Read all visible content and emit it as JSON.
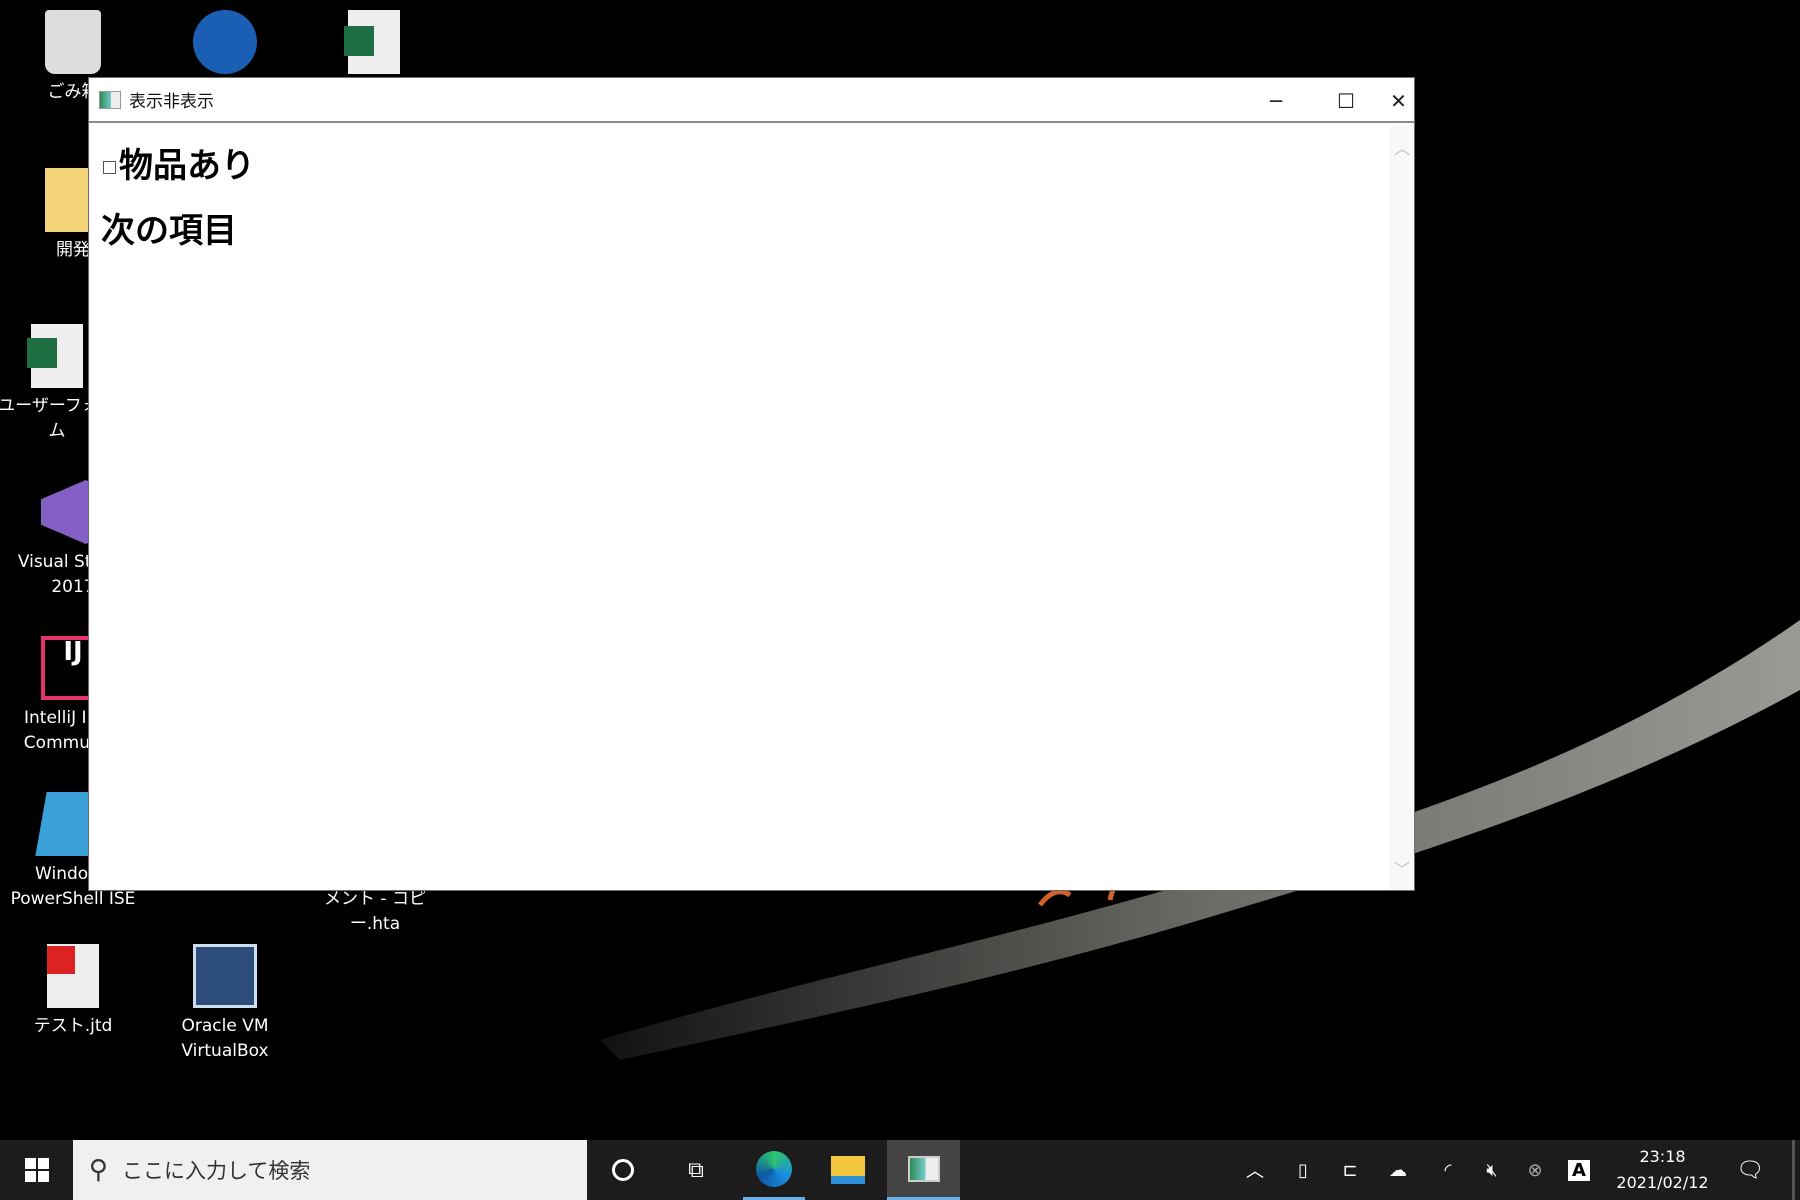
{
  "desktop": {
    "icons": [
      {
        "label": "ごみ箱",
        "icon": "recycle-bin-icon"
      },
      {
        "label": "",
        "icon": "lightning-app-icon"
      },
      {
        "label": "",
        "icon": "excel-file-icon"
      },
      {
        "label": "開発",
        "icon": "folder-icon"
      },
      {
        "label": "ユーザーフォーム",
        "icon": "excel-file-icon"
      },
      {
        "label": "Visual Studio 2017",
        "icon": "visual-studio-icon"
      },
      {
        "label": "IntelliJ IDEA Community",
        "icon": "intellij-icon"
      },
      {
        "label": "Windows PowerShell ISE",
        "icon": "powershell-icon"
      },
      {
        "label": "メント - コピー.hta",
        "icon": "hta-file-icon"
      },
      {
        "label": "テスト.jtd",
        "icon": "ichitaro-file-icon"
      },
      {
        "label": "Oracle VM VirtualBox",
        "icon": "virtualbox-icon"
      }
    ]
  },
  "window": {
    "title": "表示非表示",
    "minimize": "─",
    "maximize": "☐",
    "close": "✕",
    "checkbox_label": "物品あり",
    "checkbox_checked": false,
    "next_heading": "次の項目"
  },
  "taskbar": {
    "search_placeholder": "ここに入力して検索",
    "ime": "A",
    "time": "23:18",
    "date": "2021/02/12",
    "accent": "#6ab0e8"
  }
}
